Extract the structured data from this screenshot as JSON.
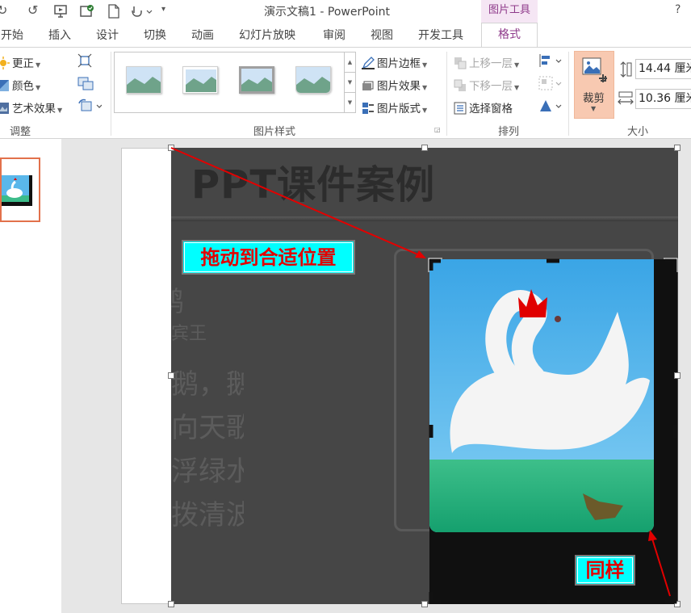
{
  "window": {
    "title": "演示文稿1 - PowerPoint",
    "context_tab": "图片工具",
    "help": "?"
  },
  "tabs": [
    "开始",
    "插入",
    "设计",
    "切换",
    "动画",
    "幻灯片放映",
    "审阅",
    "视图",
    "开发工具",
    "格式"
  ],
  "active_tab": "格式",
  "ribbon": {
    "adjust": {
      "correct": "更正",
      "color": "颜色",
      "artistic": "艺术效果",
      "label": "调整"
    },
    "picture_styles": {
      "border": "图片边框",
      "effects": "图片效果",
      "layout": "图片版式",
      "label": "图片样式"
    },
    "arrange": {
      "bring_forward": "上移一层",
      "send_backward": "下移一层",
      "selection_pane": "选择窗格",
      "label": "排列"
    },
    "size": {
      "crop": "裁剪",
      "height": "14.44 厘米",
      "width": "10.36 厘米",
      "label": "大小"
    }
  },
  "slide": {
    "title": "PPT课件案例",
    "poem_title": "鹅",
    "author": "骆宾王",
    "lines": [
      "鹅，鹅，鹅，",
      "曲项向天歌。",
      "白毛浮绿水，",
      "红掌拨清波。"
    ]
  },
  "annotations": {
    "drag_label": "拖动到合适位置",
    "same_label": "同样"
  },
  "colors": {
    "accent_context": "#8e3a8a",
    "annotation_bg": "#00ffff",
    "annotation_text": "#e30000",
    "arrow": "#e30000",
    "thumbnail_border": "#e2714b",
    "crop_active": "#f8c9b1"
  }
}
